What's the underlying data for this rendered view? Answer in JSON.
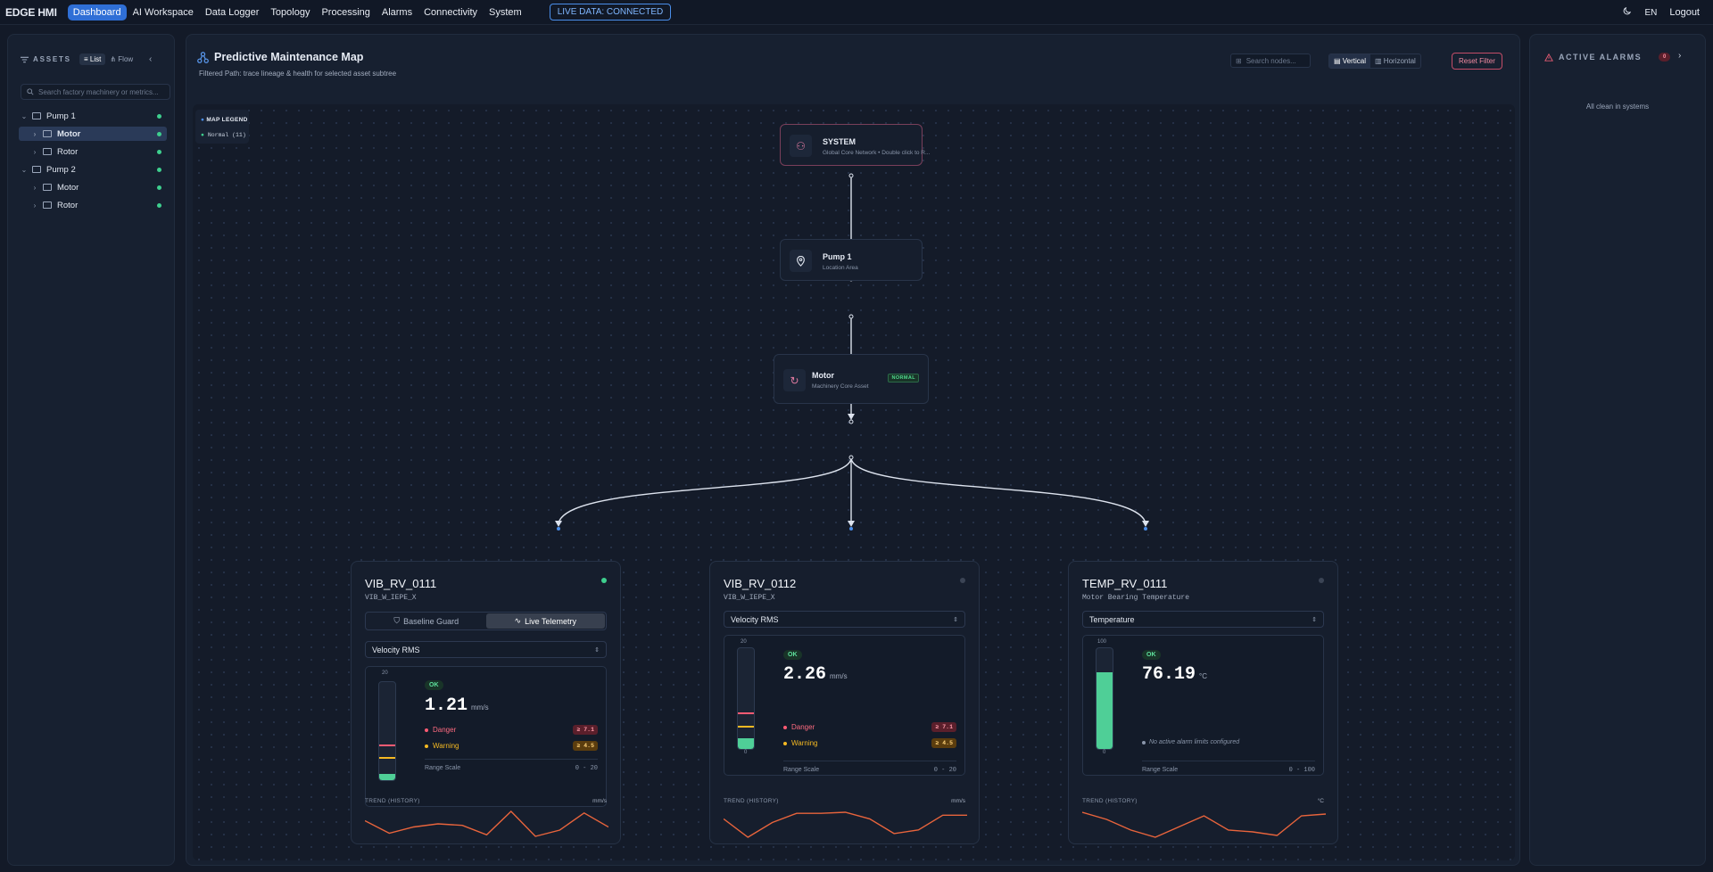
{
  "topbar": {
    "brand": "EDGE HMI",
    "nav": [
      "Dashboard",
      "AI Workspace",
      "Data Logger",
      "Topology",
      "Processing",
      "Alarms",
      "Connectivity",
      "System"
    ],
    "live_status": "LIVE DATA: CONNECTED",
    "lang": "EN",
    "logout": "Logout"
  },
  "assets": {
    "header": "ASSETS",
    "view_list": "List",
    "view_flow": "Flow",
    "search_placeholder": "Search factory machinery or metrics...",
    "tree": [
      {
        "label": "Pump 1",
        "expanded": true,
        "selected": false
      },
      {
        "label": "Motor",
        "expanded": false,
        "selected": true
      },
      {
        "label": "Rotor",
        "expanded": false,
        "selected": false
      },
      {
        "label": "Pump 2",
        "expanded": true,
        "selected": false
      },
      {
        "label": "Motor",
        "expanded": false,
        "selected": false
      },
      {
        "label": "Rotor",
        "expanded": false,
        "selected": false
      }
    ]
  },
  "map": {
    "title": "Predictive Maintenance Map",
    "subtitle": "Filtered Path: trace lineage & health for selected asset subtree",
    "search_placeholder": "Search nodes...",
    "orient_vertical": "Vertical",
    "orient_horizontal": "Horizontal",
    "reset": "Reset Filter",
    "legend_title": "MAP LEGEND",
    "legend_normal": "Normal (11)",
    "nodes": {
      "system": {
        "title": "SYSTEM",
        "subtitle": "Global Core Network • Double click to R..."
      },
      "pump": {
        "title": "Pump 1",
        "subtitle": "Location Area"
      },
      "motor": {
        "title": "Motor",
        "subtitle": "Machinery Core Asset",
        "badge": "NORMAL"
      }
    }
  },
  "sensors": [
    {
      "title": "VIB_RV_0111",
      "subtitle": "VIB_W_IEPE_X",
      "status_color": "#3ecf8e",
      "toggle": [
        "Baseline Guard",
        "Live Telemetry"
      ],
      "metric": "Velocity RMS",
      "status": "OK",
      "value": "1.21",
      "unit": "mm/s",
      "scale_max_label": "20",
      "scale_min_label": "0",
      "fill_fraction": 0.06,
      "danger_label": "Danger",
      "danger_value": "≥ 7.1",
      "warning_label": "Warning",
      "warning_value": "≥ 4.5",
      "range_label": "Range Scale",
      "range_value": "0 - 20",
      "trend_label": "TREND (HISTORY)",
      "trend_unit": "mm/s",
      "trend": [
        1.2,
        0.8,
        1.0,
        1.1,
        1.05,
        0.75,
        1.5,
        0.7,
        0.9,
        1.45,
        1.0
      ]
    },
    {
      "title": "VIB_RV_0112",
      "subtitle": "VIB_W_IEPE_X",
      "status_color": "#3b4455",
      "metric": "Velocity RMS",
      "status": "OK",
      "value": "2.26",
      "unit": "mm/s",
      "scale_max_label": "20",
      "scale_min_label": "0",
      "fill_fraction": 0.11,
      "danger_label": "Danger",
      "danger_value": "≥ 7.1",
      "warning_label": "Warning",
      "warning_value": "≥ 4.5",
      "range_label": "Range Scale",
      "range_value": "0 - 20",
      "trend_label": "TREND (HISTORY)",
      "trend_unit": "mm/s",
      "trend": [
        2.1,
        1.6,
        2.0,
        2.25,
        2.25,
        2.28,
        2.1,
        1.7,
        1.8,
        2.2,
        2.2
      ]
    },
    {
      "title": "TEMP_RV_0111",
      "subtitle": "Motor Bearing Temperature",
      "status_color": "#3b4455",
      "metric": "Temperature",
      "status": "OK",
      "value": "76.19",
      "unit": "°C",
      "scale_max_label": "100",
      "scale_min_label": "0",
      "fill_fraction": 0.7619,
      "no_alarm": "No active alarm limits configured",
      "range_label": "Range Scale",
      "range_value": "0 - 100",
      "trend_label": "TREND (HISTORY)",
      "trend_unit": "°C",
      "trend": [
        76.4,
        76.2,
        75.9,
        75.7,
        76.0,
        76.3,
        75.9,
        75.85,
        75.75,
        76.3,
        76.35
      ]
    }
  ],
  "alarms": {
    "header": "ACTIVE ALARMS",
    "count": "0",
    "empty": "All clean in systems"
  },
  "colors": {
    "accent": "#2f6fd6",
    "ok": "#3ecf8e",
    "danger": "#ff5b73",
    "warning": "#f5b922",
    "trend": "#e8643c"
  }
}
